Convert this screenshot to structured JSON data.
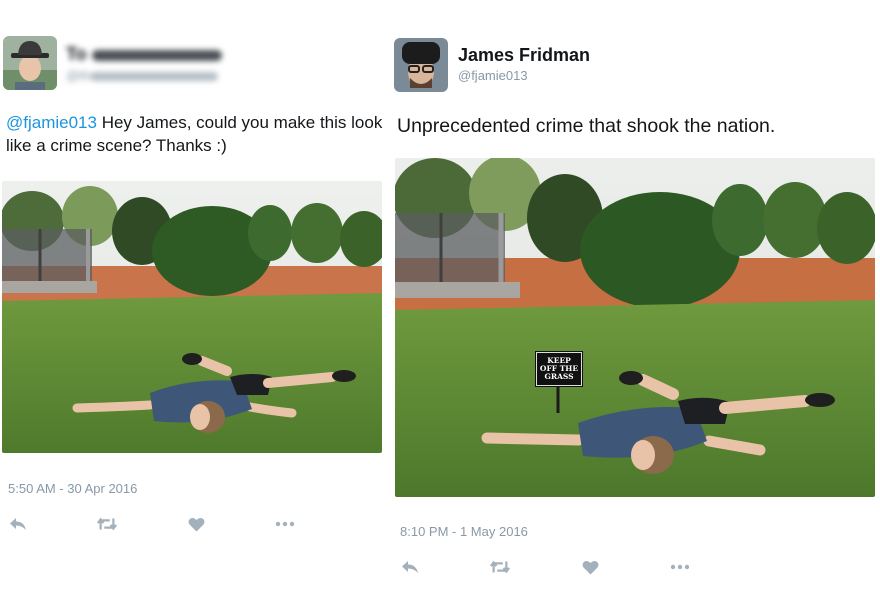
{
  "colors": {
    "link": "#1b95e0",
    "muted": "#8899a6",
    "text": "#14171a",
    "icon": "#a3b1bc"
  },
  "left_tweet": {
    "author_name": "To",
    "author_handle": "@th",
    "mention": "@fjamie013",
    "body": " Hey James, could you make this look like a crime scene? Thanks :)",
    "timestamp": "5:50 AM - 30 Apr 2016",
    "icons": [
      "reply-icon",
      "retweet-icon",
      "like-icon",
      "more-icon"
    ]
  },
  "right_tweet": {
    "author_name": "James Fridman",
    "author_handle": "@fjamie013",
    "body": "Unprecedented crime that shook the nation.",
    "timestamp": "8:10 PM - 1 May 2016",
    "sign": {
      "line1": "KEEP",
      "line2": "OFF THE",
      "line3": "GRASS"
    },
    "icons": [
      "reply-icon",
      "retweet-icon",
      "like-icon",
      "more-icon"
    ]
  }
}
